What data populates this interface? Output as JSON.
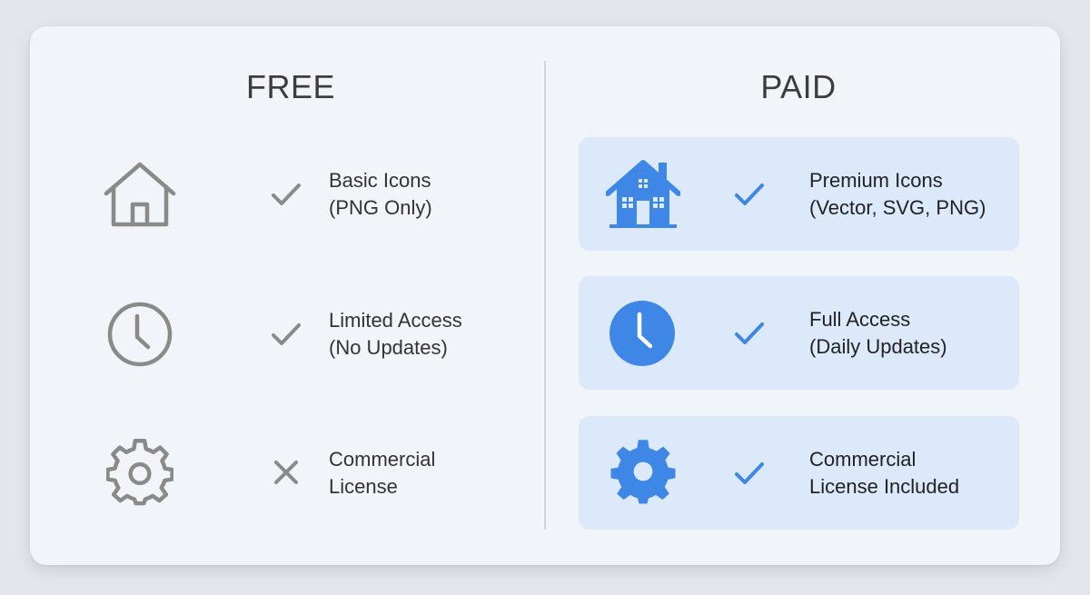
{
  "free": {
    "title": "FREE",
    "rows": [
      {
        "icon": "home-icon",
        "status": "included",
        "line1": "Basic Icons",
        "line2": "(PNG Only)"
      },
      {
        "icon": "clock-icon",
        "status": "included",
        "line1": "Limited Access",
        "line2": "(No Updates)"
      },
      {
        "icon": "gear-icon",
        "status": "excluded",
        "line1": "Commercial",
        "line2": "License"
      }
    ]
  },
  "paid": {
    "title": "PAID",
    "rows": [
      {
        "icon": "home-icon",
        "status": "included",
        "line1": "Premium Icons",
        "line2": "(Vector, SVG, PNG)"
      },
      {
        "icon": "clock-icon",
        "status": "included",
        "line1": "Full Access",
        "line2": "(Daily Updates)"
      },
      {
        "icon": "gear-icon",
        "status": "included",
        "line1": "Commercial",
        "line2": "License Included"
      }
    ]
  },
  "colors": {
    "free_icon": "#8a8a8a",
    "paid_icon": "#3f87e6",
    "paid_row_bg": "#dbe9fa",
    "card_bg": "#f1f4f8"
  }
}
